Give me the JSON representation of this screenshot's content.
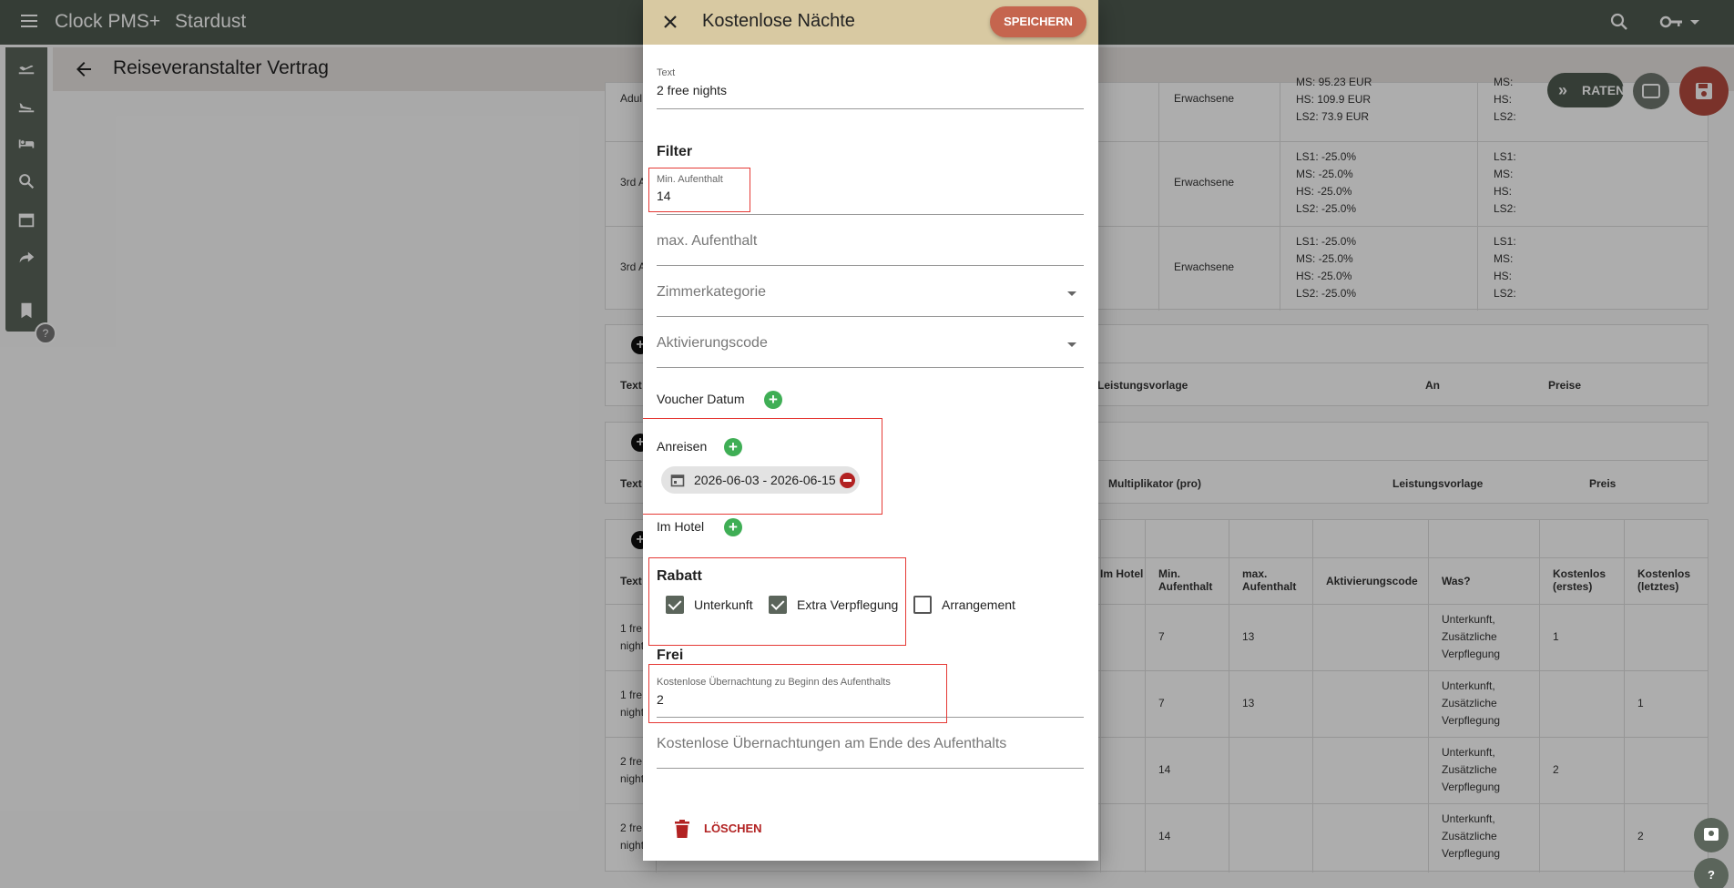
{
  "app": {
    "brand": "Clock PMS+",
    "tenant": "Stardust"
  },
  "page": {
    "title": "Reiseveranstalter Vertrag"
  },
  "actions": {
    "raten_label": "RATEN"
  },
  "tables": {
    "rates": {
      "rows": [
        {
          "text": "Adul",
          "age": "Erwachsene",
          "prices": [
            "MS:   95.23 EUR",
            "HS:   109.9 EUR",
            "LS2:   73.9 EUR"
          ],
          "right": [
            "MS:",
            "HS:",
            "LS2:"
          ]
        },
        {
          "text": "3rd A",
          "age": "Erwachsene",
          "prices": [
            "LS1:   -25.0%",
            "MS:   -25.0%",
            "HS:   -25.0%",
            "LS2:   -25.0%"
          ],
          "right": [
            "LS1:",
            "MS:",
            "HS:",
            "LS2:"
          ]
        },
        {
          "text": "3rd A",
          "age": "Erwachsene",
          "prices": [
            "LS1:   -25.0%",
            "MS:   -25.0%",
            "HS:   -25.0%",
            "LS2:   -25.0%"
          ],
          "right": [
            "LS1:",
            "MS:",
            "HS:",
            "LS2:"
          ]
        }
      ]
    },
    "services": {
      "headers": [
        "Text",
        "Leistungsvorlage",
        "An",
        "Preise"
      ]
    },
    "extras": {
      "headers": [
        "Text",
        "Multiplikator (pro)",
        "Leistungsvorlage",
        "Preis"
      ]
    },
    "free_nights": {
      "headers": [
        "Text",
        "Im Hotel",
        "Min. Aufenthalt",
        "max. Aufenthalt",
        "Aktivierungscode",
        "Was?",
        "Kostenlos (erstes)",
        "Kostenlos (letztes)"
      ],
      "rows": [
        {
          "text": "1 fre night",
          "min": "7",
          "max": "13",
          "was": "Unterkunft, Zusätzliche Verpflegung",
          "first": "1",
          "last": ""
        },
        {
          "text": "1 fre night",
          "min": "7",
          "max": "13",
          "was": "Unterkunft, Zusätzliche Verpflegung",
          "first": "",
          "last": "1"
        },
        {
          "text": "2 fre night",
          "min": "14",
          "max": "",
          "was": "Unterkunft, Zusätzliche Verpflegung",
          "first": "2",
          "last": ""
        },
        {
          "text": "2 fre night",
          "min": "14",
          "max": "",
          "was": "Unterkunft, Zusätzliche Verpflegung",
          "first": "",
          "last": "2"
        }
      ]
    }
  },
  "dialog": {
    "title": "Kostenlose Nächte",
    "save_label": "SPEICHERN",
    "text_field": {
      "label": "Text",
      "value": "2 free nights"
    },
    "filter_heading": "Filter",
    "min_stay": {
      "label": "Min. Aufenthalt",
      "value": "14"
    },
    "max_stay": {
      "placeholder": "max. Aufenthalt"
    },
    "room_category": {
      "placeholder": "Zimmerkategorie"
    },
    "activation_code": {
      "placeholder": "Aktivierungscode"
    },
    "voucher_date_label": "Voucher Datum",
    "arrivals_label": "Anreisen",
    "arrival_chip": "2026-06-03 - 2026-06-15",
    "in_hotel_label": "Im Hotel",
    "discount_heading": "Rabatt",
    "checkboxes": [
      {
        "label": "Unterkunft",
        "checked": true
      },
      {
        "label": "Extra Verpflegung",
        "checked": true
      },
      {
        "label": "Arrangement",
        "checked": false
      }
    ],
    "free_heading": "Frei",
    "free_start": {
      "label": "Kostenlose Übernachtung zu Beginn des Aufenthalts",
      "value": "2"
    },
    "free_end": {
      "placeholder": "Kostenlose Übernachtungen am Ende des Aufenthalts"
    },
    "delete_label": "LÖSCHEN"
  },
  "colors": {
    "topbar": "#4f5b50",
    "dialog_header": "#d8c9a2",
    "save": "#c5654e",
    "add": "#3fae55",
    "danger": "#b22222",
    "highlight": "#e53935"
  },
  "icons": [
    "menu-icon",
    "search-icon",
    "key-icon",
    "close-icon",
    "back-icon",
    "calendar-icon",
    "remove-icon",
    "add-icon",
    "delete-icon"
  ]
}
